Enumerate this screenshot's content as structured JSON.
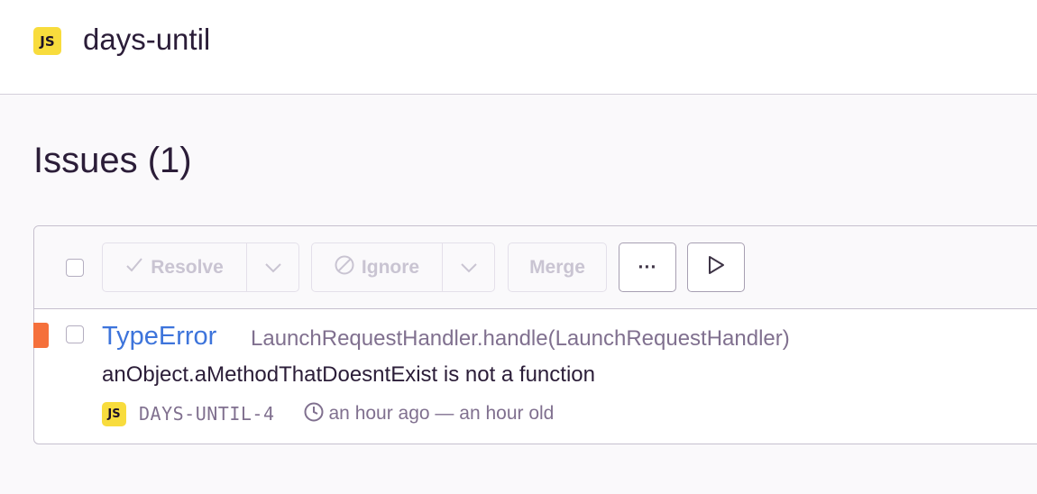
{
  "header": {
    "platform_badge": "JS",
    "project_name": "days-until"
  },
  "page": {
    "title": "Issues (1)"
  },
  "toolbar": {
    "resolve_label": "Resolve",
    "ignore_label": "Ignore",
    "merge_label": "Merge",
    "more_label": "···",
    "resolve_icon": "checkmark-icon",
    "ignore_icon": "prohibit-icon",
    "dropdown_icon": "chevron-down-icon",
    "play_icon": "play-icon"
  },
  "issues": [
    {
      "level_color": "#f5703b",
      "type": "TypeError",
      "culprit": "LaunchRequestHandler.handle(LaunchRequestHandler)",
      "message": "anObject.aMethodThatDoesntExist is not a function",
      "platform_badge": "JS",
      "short_id": "DAYS-UNTIL-4",
      "time": "an hour ago — an hour old"
    }
  ],
  "colors": {
    "link_blue": "#3d74db",
    "muted_text": "#80708f",
    "js_yellow": "#f8dc3d"
  }
}
